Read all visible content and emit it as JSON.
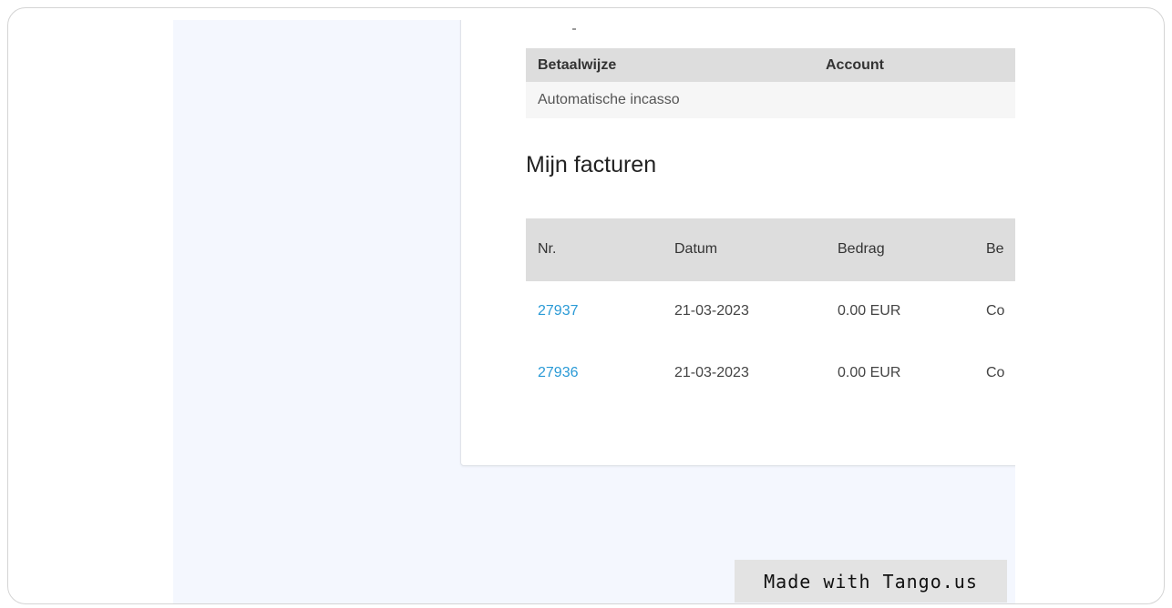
{
  "payment": {
    "headers": [
      "Betaalwijze",
      "Account"
    ],
    "rows": [
      [
        "Automatische incasso",
        ""
      ]
    ]
  },
  "invoices": {
    "title": "Mijn facturen",
    "headers": [
      "Nr.",
      "Datum",
      "Bedrag",
      "Be"
    ],
    "rows": [
      {
        "nr": "27937",
        "datum": "21-03-2023",
        "bedrag": "0.00 EUR",
        "status": "Co"
      },
      {
        "nr": "27936",
        "datum": "21-03-2023",
        "bedrag": "0.00 EUR",
        "status": "Co"
      }
    ]
  },
  "watermark": "Made with Tango.us",
  "colors": {
    "link": "#2a9ad6",
    "page_background": "#f4f7fe",
    "table_header": "#dddddd"
  }
}
